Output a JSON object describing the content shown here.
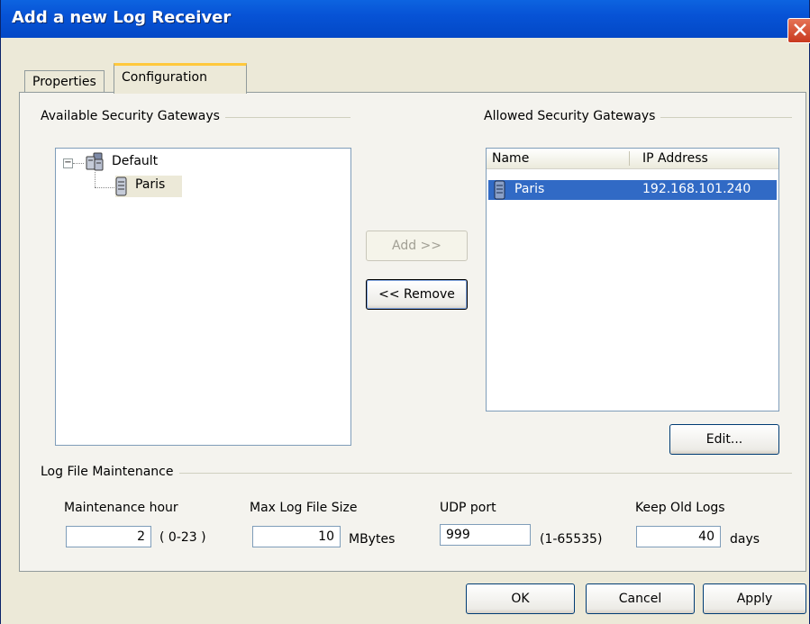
{
  "window": {
    "title": "Add a new Log Receiver"
  },
  "tabs": [
    {
      "label": "Properties"
    },
    {
      "label": "Configuration"
    }
  ],
  "available": {
    "group_label": "Available Security Gateways",
    "tree": {
      "root": {
        "label": "Default",
        "toggle": "−"
      },
      "child": {
        "label": "Paris"
      }
    }
  },
  "buttons": {
    "add": "Add >>",
    "remove": "<< Remove",
    "edit": "Edit...",
    "ok": "OK",
    "cancel": "Cancel",
    "apply": "Apply"
  },
  "allowed": {
    "group_label": "Allowed Security Gateways",
    "columns": [
      "Name",
      "IP Address"
    ],
    "rows": [
      {
        "name": "Paris",
        "ip": "192.168.101.240",
        "selected": true
      }
    ]
  },
  "maintenance": {
    "group_label": "Log File Maintenance",
    "hour_label": "Maintenance hour",
    "hour_value": "2",
    "hour_range": "( 0-23 )",
    "size_label": "Max Log File Size",
    "size_value": "10",
    "size_unit": "MBytes",
    "udp_label": "UDP port",
    "udp_value": "999",
    "udp_range": "(1-65535)",
    "keep_label": "Keep Old Logs",
    "keep_value": "40",
    "keep_unit": "days"
  },
  "colors": {
    "title_bar": "#0753d6",
    "selection": "#316ac5",
    "close": "#c8391e",
    "tab_highlight": "#ffc83c"
  }
}
